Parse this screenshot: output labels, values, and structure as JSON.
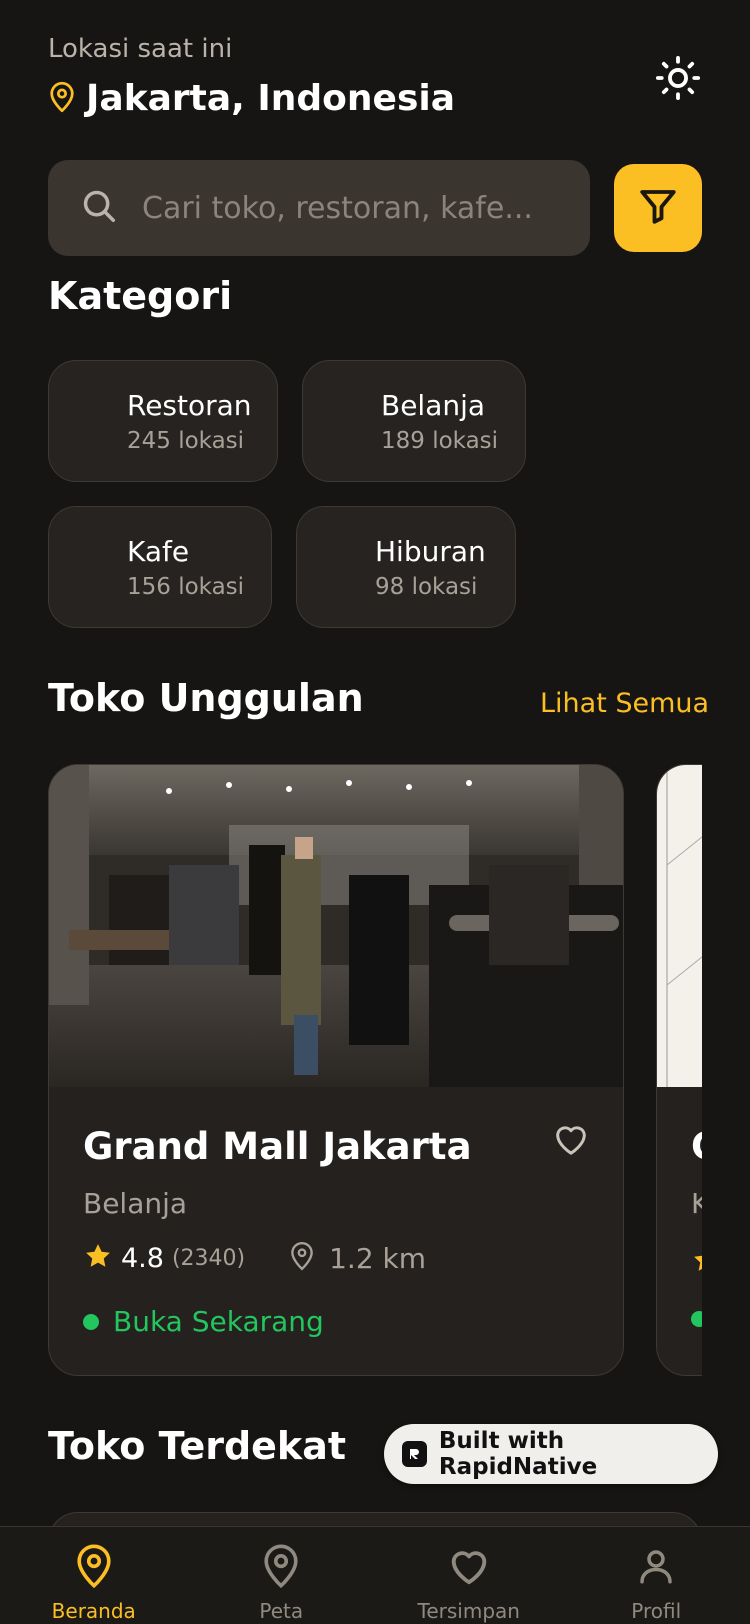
{
  "header": {
    "location_label": "Lokasi saat ini",
    "location_city": "Jakarta, Indonesia"
  },
  "search": {
    "placeholder": "Cari toko, restoran, kafe..."
  },
  "categories": {
    "title": "Kategori",
    "items": [
      {
        "name": "Restoran",
        "count": "245 lokasi"
      },
      {
        "name": "Belanja",
        "count": "189 lokasi"
      },
      {
        "name": "Kafe",
        "count": "156 lokasi"
      },
      {
        "name": "Hiburan",
        "count": "98 lokasi"
      }
    ]
  },
  "featured": {
    "title": "Toko Unggulan",
    "see_all": "Lihat Semua",
    "stores": [
      {
        "name": "Grand Mall Jakarta",
        "category": "Belanja",
        "rating": "4.8",
        "reviews": "(2340)",
        "distance": "1.2 km",
        "status": "Buka Sekarang"
      },
      {
        "name": "C",
        "category": "K"
      }
    ]
  },
  "nearby": {
    "title": "Toko Terdekat"
  },
  "badge": {
    "label": "Built with RapidNative"
  },
  "nav": {
    "items": [
      {
        "label": "Beranda",
        "icon": "map-pin-icon",
        "active": true
      },
      {
        "label": "Peta",
        "icon": "map-pin-icon",
        "active": false
      },
      {
        "label": "Tersimpan",
        "icon": "heart-icon",
        "active": false
      },
      {
        "label": "Profil",
        "icon": "user-icon",
        "active": false
      }
    ]
  },
  "colors": {
    "background": "#171513",
    "accent": "#fbbf24",
    "open": "#22c55e",
    "card": "#24211e"
  }
}
